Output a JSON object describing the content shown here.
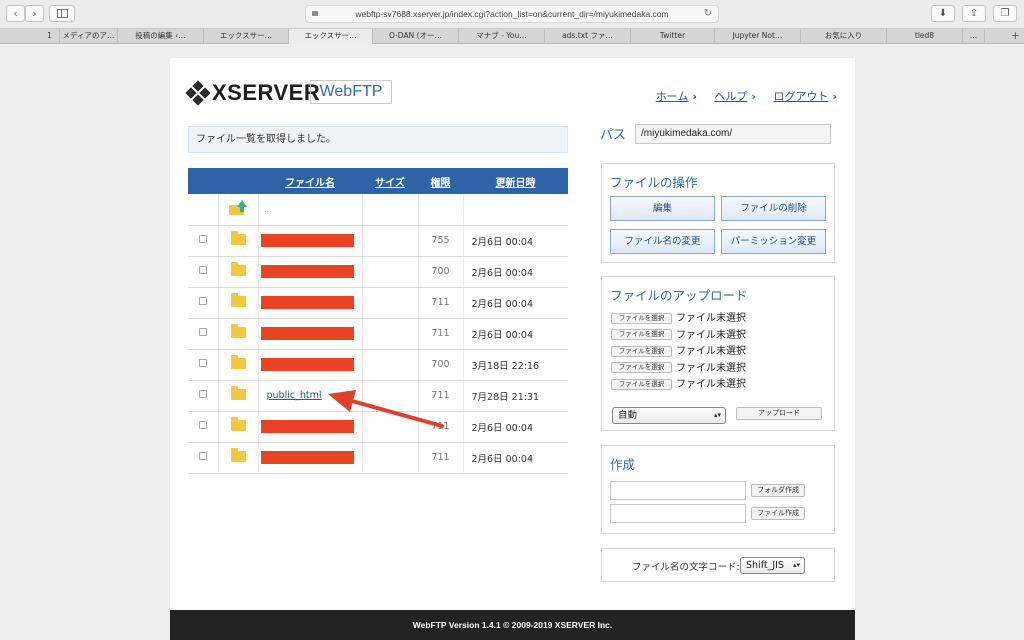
{
  "browser": {
    "url": "webftp-sv7688.xserver.jp/index.cgi?action_list=on&current_dir=/miyukimedaka.com",
    "tabs": [
      "1",
      "メディアのア…",
      "投稿の編集 ‹…",
      "エックスサー…",
      "エックスサー…",
      "O-DAN (オー…",
      "マナブ - You…",
      "ads.txt ファ…",
      "Twitter",
      "Jupyter Not…",
      "お気に入り",
      "tled8",
      "…"
    ],
    "active_tab_index": 4
  },
  "header": {
    "logo_text": "XSERVER",
    "badge": "WebFTP",
    "links": [
      "ホーム",
      "ヘルプ",
      "ログアウト"
    ]
  },
  "message": "ファイル一覧を取得しました。",
  "table": {
    "headers": [
      "ファイル名",
      "サイズ",
      "権限",
      "更新日時"
    ],
    "parent_label": "..",
    "rows": [
      {
        "name": "",
        "redacted": true,
        "perm": "755",
        "date": "2月6日 00:04"
      },
      {
        "name": "",
        "redacted": true,
        "perm": "700",
        "date": "2月6日 00:04"
      },
      {
        "name": "",
        "redacted": true,
        "perm": "711",
        "date": "2月6日 00:04"
      },
      {
        "name": "",
        "redacted": true,
        "perm": "711",
        "date": "2月6日 00:04"
      },
      {
        "name": "",
        "redacted": true,
        "perm": "700",
        "date": "3月18日 22:16"
      },
      {
        "name": "public_html",
        "redacted": false,
        "perm": "711",
        "date": "7月28日 21:31"
      },
      {
        "name": "",
        "redacted": true,
        "perm": "711",
        "date": "2月6日 00:04"
      },
      {
        "name": "",
        "redacted": true,
        "perm": "711",
        "date": "2月6日 00:04"
      }
    ]
  },
  "path": {
    "label": "パス",
    "value": "/miyukimedaka.com/"
  },
  "ops": {
    "title": "ファイルの操作",
    "buttons": [
      "編集",
      "ファイルの削除",
      "ファイル名の変更",
      "パーミッション変更"
    ]
  },
  "upload": {
    "title": "ファイルのアップロード",
    "choose_label": "ファイルを選択",
    "status": "ファイル未選択",
    "count": 5,
    "mode": "自動",
    "submit": "アップロード"
  },
  "create": {
    "title": "作成",
    "folder_button": "フォルダ作成",
    "file_button": "ファイル作成"
  },
  "encoding": {
    "label": "ファイル名の文字コード:",
    "value": "Shift_JIS"
  },
  "footer": "WebFTP Version 1.4.1 © 2009-2019 XSERVER Inc."
}
